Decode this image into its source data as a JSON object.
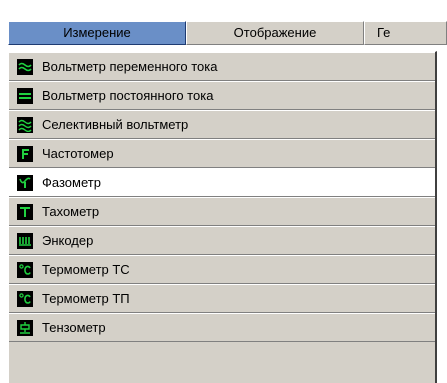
{
  "menubar": {
    "tabs": [
      {
        "label": "Измерение"
      },
      {
        "label": "Отображение"
      },
      {
        "label": "Ге"
      }
    ]
  },
  "menu": {
    "items": [
      {
        "label": "Вольтметр переменного тока",
        "icon": "ac-wave-icon"
      },
      {
        "label": "Вольтметр постоянного тока",
        "icon": "dc-lines-icon"
      },
      {
        "label": "Селективный вольтметр",
        "icon": "selective-wave-icon"
      },
      {
        "label": "Частотомер",
        "icon": "f-letter-icon"
      },
      {
        "label": "Фазометр",
        "icon": "phase-icon"
      },
      {
        "label": "Тахометр",
        "icon": "t-letter-icon"
      },
      {
        "label": "Энкодер",
        "icon": "encoder-comb-icon"
      },
      {
        "label": "Термометр ТС",
        "icon": "celsius-icon"
      },
      {
        "label": "Термометр ТП",
        "icon": "celsius-icon"
      },
      {
        "label": "Тензометр",
        "icon": "strain-gauge-icon"
      }
    ]
  },
  "colors": {
    "icon_fg": "#20d040",
    "icon_bg": "#000000",
    "active_tab": "#6a8fc7",
    "menu_bg": "#d4d0c8",
    "highlight": "#ffffff"
  }
}
